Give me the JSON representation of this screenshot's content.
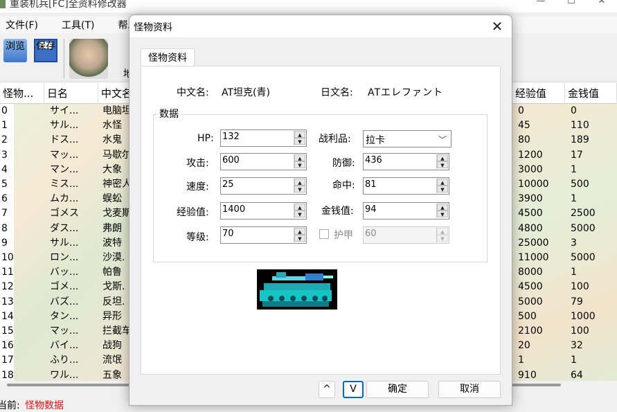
{
  "app": {
    "title": "重装机兵[FC]全资料修改器",
    "menu": [
      "文件(F)",
      "工具(T)",
      "帮助"
    ],
    "toolbar": {
      "browse": "浏览",
      "save": "保存",
      "cut_label": "地"
    }
  },
  "table": {
    "headers": [
      "怪物...",
      "日名",
      "中文名",
      "经验值",
      "金钱值"
    ],
    "rows": [
      {
        "id": "0",
        "jp": "サイ...",
        "cn": "电脑坦",
        "exp": "0",
        "gold": "0"
      },
      {
        "id": "1",
        "jp": "サル...",
        "cn": "水怪",
        "exp": "45",
        "gold": "110"
      },
      {
        "id": "2",
        "jp": "ドス...",
        "cn": "水鬼",
        "exp": "80",
        "gold": "189"
      },
      {
        "id": "3",
        "jp": "マッ...",
        "cn": "马歇尔",
        "exp": "1200",
        "gold": "17"
      },
      {
        "id": "4",
        "jp": "マン...",
        "cn": "大象",
        "exp": "3000",
        "gold": "1"
      },
      {
        "id": "5",
        "jp": "ミス...",
        "cn": "神密人",
        "exp": "10000",
        "gold": "500"
      },
      {
        "id": "6",
        "jp": "ムカ...",
        "cn": "蜈蚣",
        "exp": "3900",
        "gold": "1"
      },
      {
        "id": "7",
        "jp": "ゴメス",
        "cn": "戈麦斯",
        "exp": "4500",
        "gold": "2500"
      },
      {
        "id": "8",
        "jp": "ダス...",
        "cn": "弗朗",
        "exp": "4800",
        "gold": "5000"
      },
      {
        "id": "9",
        "jp": "サル...",
        "cn": "波特",
        "exp": "25000",
        "gold": "3"
      },
      {
        "id": "10",
        "jp": "ロン...",
        "cn": "沙漠.",
        "exp": "11000",
        "gold": "5000"
      },
      {
        "id": "11",
        "jp": "バッ...",
        "cn": "帕鲁",
        "exp": "8000",
        "gold": "1"
      },
      {
        "id": "12",
        "jp": "ゴメ...",
        "cn": "戈斯.",
        "exp": "4500",
        "gold": "100"
      },
      {
        "id": "13",
        "jp": "バズ...",
        "cn": "反坦.",
        "exp": "5000",
        "gold": "79"
      },
      {
        "id": "14",
        "jp": "タン...",
        "cn": "异形",
        "exp": "500",
        "gold": "1000"
      },
      {
        "id": "15",
        "jp": "マッ...",
        "cn": "拦截车",
        "exp": "2100",
        "gold": "100"
      },
      {
        "id": "16",
        "jp": "バイ...",
        "cn": "战狗",
        "exp": "20",
        "gold": "32"
      },
      {
        "id": "17",
        "jp": "ふり...",
        "cn": "流氓",
        "exp": "1",
        "gold": "1"
      },
      {
        "id": "18",
        "jp": "ワル...",
        "cn": "五象",
        "exp": "910",
        "gold": "64"
      }
    ]
  },
  "status": {
    "label": "当前:",
    "value": "怪物数据"
  },
  "dialog": {
    "title": "怪物资料",
    "tab": "怪物资料",
    "cn_name_label": "中文名:",
    "cn_name": "AT坦克(青)",
    "jp_name_label": "日文名:",
    "jp_name": "ATエレファント",
    "group_title": "数据",
    "fields": {
      "hp": {
        "label": "HP:",
        "value": "132"
      },
      "attack": {
        "label": "攻击:",
        "value": "600"
      },
      "speed": {
        "label": "速度:",
        "value": "25"
      },
      "exp": {
        "label": "经验值:",
        "value": "1400"
      },
      "level": {
        "label": "等级:",
        "value": "70"
      },
      "loot": {
        "label": "战利品:",
        "value": "拉卡"
      },
      "defense": {
        "label": "防御:",
        "value": "436"
      },
      "accuracy": {
        "label": "命中:",
        "value": "81"
      },
      "gold": {
        "label": "金钱值:",
        "value": "94"
      },
      "armor": {
        "label": "护甲",
        "value": "60",
        "checked": false
      }
    },
    "buttons": {
      "up": "^",
      "down": "V",
      "ok": "确定",
      "cancel": "取消"
    },
    "close": "✕"
  },
  "icons": {
    "browse": "folder-icon",
    "save": "floppy-disk-icon",
    "close": "close-icon"
  }
}
